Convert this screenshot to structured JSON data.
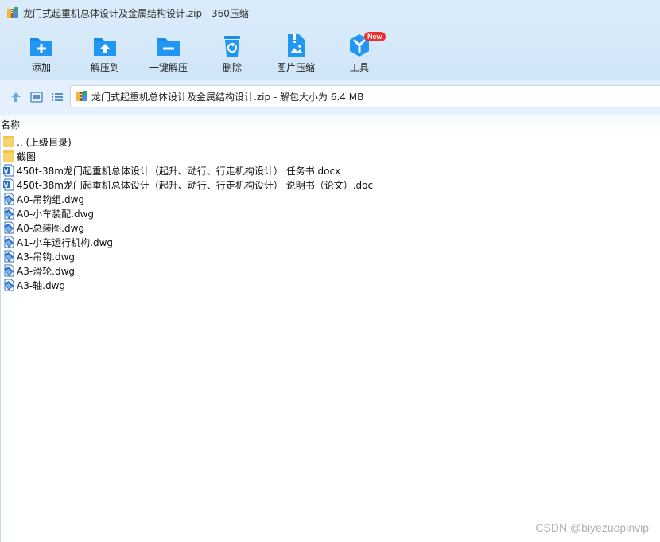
{
  "window": {
    "title": "龙门式起重机总体设计及金属结构设计.zip - 360压缩"
  },
  "toolbar": {
    "buttons": [
      {
        "label": "添加",
        "icon": "add-icon"
      },
      {
        "label": "解压到",
        "icon": "extract-to-icon"
      },
      {
        "label": "一键解压",
        "icon": "one-click-extract-icon"
      },
      {
        "label": "删除",
        "icon": "delete-icon"
      },
      {
        "label": "图片压缩",
        "icon": "image-compress-icon"
      },
      {
        "label": "工具",
        "icon": "tools-icon",
        "badge": "New"
      }
    ]
  },
  "address": {
    "text": "龙门式起重机总体设计及金属结构设计.zip - 解包大小为 6.4 MB"
  },
  "columns": {
    "name": "名称"
  },
  "files": [
    {
      "name": ".. (上级目录)",
      "type": "folder"
    },
    {
      "name": "截图",
      "type": "folder"
    },
    {
      "name": "450t-38m龙门起重机总体设计（起升、动行、行走机构设计） 任务书.docx",
      "type": "word"
    },
    {
      "name": "450t-38m龙门起重机总体设计（起升、动行、行走机构设计） 说明书（论文）.doc",
      "type": "word"
    },
    {
      "name": "A0-吊钩组.dwg",
      "type": "dwg"
    },
    {
      "name": "A0-小车装配.dwg",
      "type": "dwg"
    },
    {
      "name": "A0-总装图.dwg",
      "type": "dwg"
    },
    {
      "name": "A1-小车运行机构.dwg",
      "type": "dwg"
    },
    {
      "name": "A3-吊钩.dwg",
      "type": "dwg"
    },
    {
      "name": "A3-滑轮.dwg",
      "type": "dwg"
    },
    {
      "name": "A3-轴.dwg",
      "type": "dwg"
    }
  ],
  "watermark": "CSDN @biyezuopinvip",
  "colors": {
    "accent": "#1a8be8",
    "toolbar_bg": "#d9ebfa",
    "folder": "#f7d56a",
    "badge": "#ef2d2d"
  }
}
